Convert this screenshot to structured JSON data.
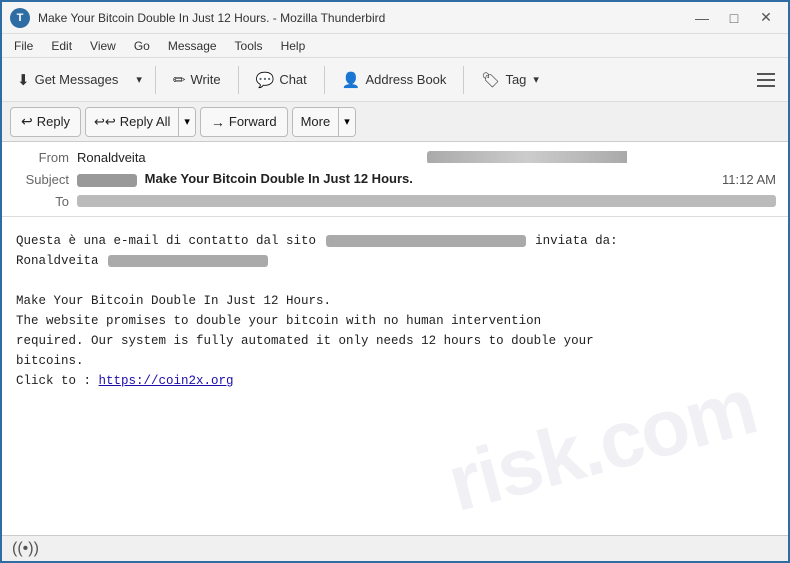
{
  "window": {
    "title": "Make Your Bitcoin Double In Just 12 Hours. - Mozilla Thunderbird",
    "icon_label": "T"
  },
  "title_controls": {
    "minimize": "—",
    "maximize": "□",
    "close": "✕"
  },
  "menu": {
    "items": [
      "File",
      "Edit",
      "View",
      "Go",
      "Message",
      "Tools",
      "Help"
    ]
  },
  "toolbar": {
    "get_messages_label": "Get Messages",
    "write_label": "Write",
    "chat_label": "Chat",
    "address_book_label": "Address Book",
    "tag_label": "Tag"
  },
  "action_toolbar": {
    "reply_label": "Reply",
    "reply_all_label": "Reply All",
    "forward_label": "Forward",
    "more_label": "More"
  },
  "email": {
    "from_label": "From",
    "from_name": "Ronaldveita",
    "from_email_blurred": true,
    "subject_label": "Subject",
    "subject_prefix_blurred": true,
    "subject_text": "Make Your Bitcoin Double In Just 12 Hours.",
    "time": "11:12 AM",
    "to_label": "To",
    "to_blurred": true,
    "body_line1_prefix": "Questa è una e-mail di contatto dal sito",
    "body_line1_suffix": "inviata da:",
    "body_line2": "Ronaldveita",
    "body_spacer": "",
    "body_line3": "Make Your Bitcoin Double In Just 12 Hours.",
    "body_line4": "The website promises to double your bitcoin with no human intervention",
    "body_line5": "required. Our system is fully automated it only needs 12 hours to double your",
    "body_line6": "bitcoins.",
    "body_link_prefix": "Click to : ",
    "body_link_text": "https://coin2x.org",
    "body_link_href": "https://coin2x.org"
  },
  "watermark": {
    "text": "risk.com"
  },
  "status_bar": {
    "icon": "((•))"
  }
}
